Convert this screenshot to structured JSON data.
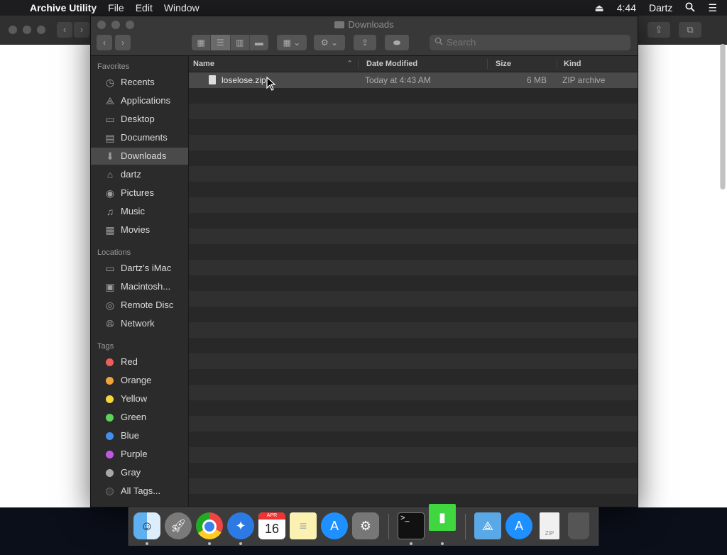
{
  "menubar": {
    "app_name": "Archive Utility",
    "menus": [
      "File",
      "Edit",
      "Window"
    ],
    "clock": "4:44",
    "user": "Dartz"
  },
  "window": {
    "title": "Downloads",
    "search": {
      "placeholder": "Search"
    }
  },
  "sidebar": {
    "favorites_header": "Favorites",
    "favorites": [
      {
        "label": "Recents",
        "icon": "recents-icon"
      },
      {
        "label": "Applications",
        "icon": "applications-icon"
      },
      {
        "label": "Desktop",
        "icon": "desktop-icon"
      },
      {
        "label": "Documents",
        "icon": "documents-icon"
      },
      {
        "label": "Downloads",
        "icon": "downloads-icon",
        "selected": true
      },
      {
        "label": "dartz",
        "icon": "home-icon"
      },
      {
        "label": "Pictures",
        "icon": "pictures-icon"
      },
      {
        "label": "Music",
        "icon": "music-icon"
      },
      {
        "label": "Movies",
        "icon": "movies-icon"
      }
    ],
    "locations_header": "Locations",
    "locations": [
      {
        "label": "Dartz’s iMac",
        "icon": "imac-icon"
      },
      {
        "label": "Macintosh...",
        "icon": "hard-drive-icon"
      },
      {
        "label": "Remote Disc",
        "icon": "disc-icon"
      },
      {
        "label": "Network",
        "icon": "network-icon"
      }
    ],
    "tags_header": "Tags",
    "tags": [
      {
        "label": "Red",
        "color": "#ec5f5a"
      },
      {
        "label": "Orange",
        "color": "#f0a33a"
      },
      {
        "label": "Yellow",
        "color": "#f5d63d"
      },
      {
        "label": "Green",
        "color": "#5bd25a"
      },
      {
        "label": "Blue",
        "color": "#3f8ef0"
      },
      {
        "label": "Purple",
        "color": "#bf5ae0"
      },
      {
        "label": "Gray",
        "color": "#a8a8a8"
      },
      {
        "label": "All Tags...",
        "color": "#555555"
      }
    ]
  },
  "columns": {
    "name": "Name",
    "date": "Date Modified",
    "size": "Size",
    "kind": "Kind"
  },
  "files": [
    {
      "name": "loselose.zip",
      "date": "Today at 4:43 AM",
      "size": "6 MB",
      "kind": "ZIP archive",
      "selected": true
    }
  ],
  "dock": {
    "apps": [
      "Finder",
      "Launchpad",
      "Chrome",
      "Safari",
      "Calendar",
      "Notes",
      "App Store",
      "System Preferences",
      "Terminal",
      "Archive Utility",
      "Applications",
      "Downloads",
      "Document",
      "Trash"
    ],
    "calendar_month": "APR",
    "calendar_day": "16",
    "doc_label": "ZIP"
  }
}
